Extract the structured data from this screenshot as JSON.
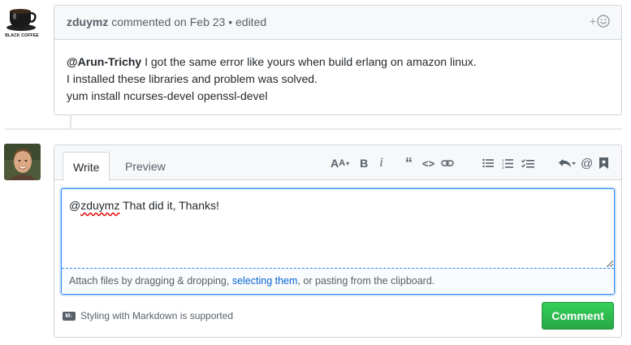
{
  "previous_comment": {
    "avatar_label": "BLACK COFFEE",
    "author": "zduymz",
    "meta": "commented on Feb 23 • edited",
    "mention": "@Arun-Trichy",
    "line1_rest": " I got the same error like yours when build erlang on amazon linux.",
    "line2": "I installed these libraries and problem was solved.",
    "line3": "yum install ncurses-devel openssl-devel",
    "reaction_plus": "+"
  },
  "editor": {
    "tab_write": "Write",
    "tab_preview": "Preview",
    "text_prefix": "@",
    "text_misspelled": "zduymz",
    "text_rest": " That did it, Thanks!",
    "attach_prefix": "Attach files by dragging & dropping, ",
    "attach_link": "selecting them",
    "attach_suffix": ", or pasting from the clipboard.",
    "markdown_note": "Styling with Markdown is supported",
    "markdown_badge": "M↓",
    "submit_label": "Comment",
    "toolbar_icons": [
      "text-size-icon",
      "bold-icon",
      "italic-icon",
      "quote-icon",
      "code-icon",
      "link-icon",
      "unordered-list-icon",
      "ordered-list-icon",
      "task-list-icon",
      "reply-icon",
      "mention-icon",
      "saved-reply-icon"
    ]
  },
  "colors": {
    "accent_blue": "#0366d6",
    "button_green": "#28a745",
    "border": "#d1d5da",
    "header_bg": "#f6f8fa"
  }
}
